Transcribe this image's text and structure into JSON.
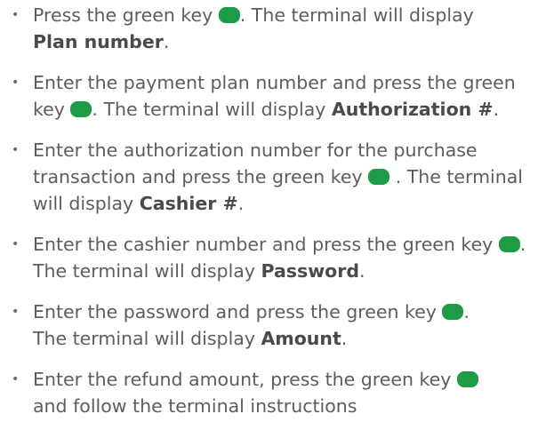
{
  "colors": {
    "text": "#5d5d5d",
    "bold_text": "#4a4a4a",
    "green_key": "#1d9b46"
  },
  "bullet_glyph": "•",
  "key_icon": "green-key-icon",
  "steps": [
    {
      "line1_a": "Press the green key ",
      "line1_b": ". The terminal will display",
      "line2_bold": "Plan number",
      "line2_tail": "."
    },
    {
      "line1": "Enter the payment plan number and press the green",
      "line2_a": "key ",
      "line2_b": ". The terminal will display ",
      "line2_bold": "Authorization #",
      "line2_tail": "."
    },
    {
      "line1": "Enter the authorization number for the purchase",
      "line2_a": "transaction and press the green key ",
      "line2_b": " . The terminal",
      "line3_a": "will display ",
      "line3_bold": "Cashier #",
      "line3_tail": "."
    },
    {
      "line1_a": "Enter the cashier number and press the green key ",
      "line1_b": ".",
      "line2_a": "The terminal will display ",
      "line2_bold": "Password",
      "line2_tail": "."
    },
    {
      "line1_a": "Enter the password and press the green key ",
      "line1_b": ".",
      "line2_a": "The terminal will display ",
      "line2_bold": "Amount",
      "line2_tail": "."
    },
    {
      "line1_a": "Enter the refund amount, press the green key ",
      "line2": "and follow the terminal instructions"
    }
  ]
}
